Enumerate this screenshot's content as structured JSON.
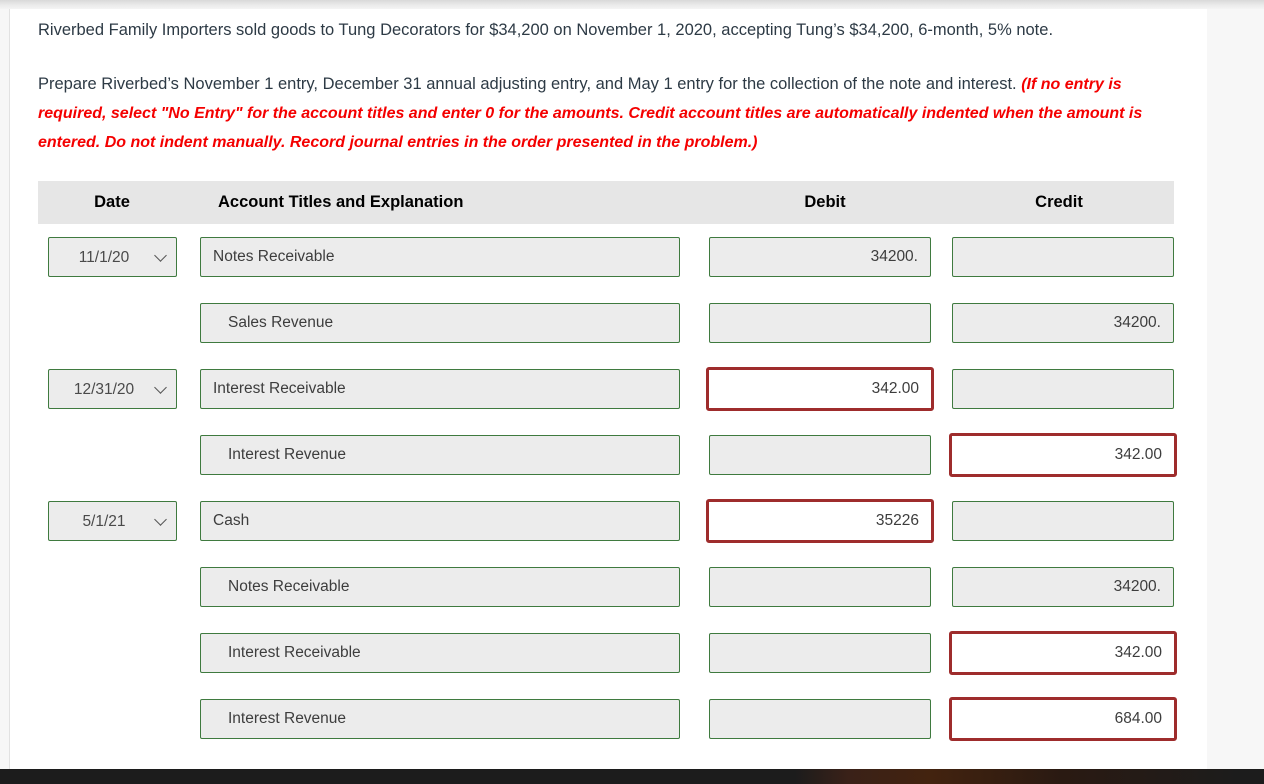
{
  "problem": {
    "paragraph1": "Riverbed Family Importers sold goods to Tung Decorators for $34,200 on November 1, 2020, accepting Tung’s $34,200, 6-month, 5% note.",
    "paragraph2_lead": "Prepare Riverbed’s November 1 entry, December 31 annual adjusting entry, and May 1 entry for the collection of the note and interest. ",
    "paragraph2_hint": "(If no entry is required, select \"No Entry\" for the account titles and enter 0 for the amounts. Credit account titles are automatically indented when the amount is entered. Do not indent manually. Record journal entries in the order presented in the problem.)"
  },
  "table": {
    "headers": {
      "date": "Date",
      "account": "Account Titles and Explanation",
      "debit": "Debit",
      "credit": "Credit"
    },
    "rows": [
      {
        "date": "11/1/20",
        "has_date": true,
        "account": "Notes Receivable",
        "indent": false,
        "debit": "34200.",
        "credit": "",
        "debit_state": "ok",
        "credit_state": "ok"
      },
      {
        "date": "",
        "has_date": false,
        "account": "Sales Revenue",
        "indent": true,
        "debit": "",
        "credit": "34200.",
        "debit_state": "ok",
        "credit_state": "ok"
      },
      {
        "date": "12/31/20",
        "has_date": true,
        "account": "Interest Receivable",
        "indent": false,
        "debit": "342.00",
        "credit": "",
        "debit_state": "bad",
        "credit_state": "ok"
      },
      {
        "date": "",
        "has_date": false,
        "account": "Interest Revenue",
        "indent": true,
        "debit": "",
        "credit": "342.00",
        "debit_state": "ok",
        "credit_state": "bad"
      },
      {
        "date": "5/1/21",
        "has_date": true,
        "account": "Cash",
        "indent": false,
        "debit": "35226",
        "credit": "",
        "debit_state": "bad",
        "credit_state": "ok"
      },
      {
        "date": "",
        "has_date": false,
        "account": "Notes Receivable",
        "indent": true,
        "debit": "",
        "credit": "34200.",
        "debit_state": "ok",
        "credit_state": "ok"
      },
      {
        "date": "",
        "has_date": false,
        "account": "Interest Receivable",
        "indent": true,
        "debit": "",
        "credit": "342.00",
        "debit_state": "ok",
        "credit_state": "bad"
      },
      {
        "date": "",
        "has_date": false,
        "account": "Interest Revenue",
        "indent": true,
        "debit": "",
        "credit": "684.00",
        "debit_state": "ok",
        "credit_state": "bad"
      }
    ]
  },
  "colors": {
    "field_border_ok": "#3f7a3f",
    "field_border_bad": "#9e2c2c",
    "hint_text": "#f40000",
    "header_bg": "#e6e6e6",
    "field_bg": "#ececec"
  }
}
